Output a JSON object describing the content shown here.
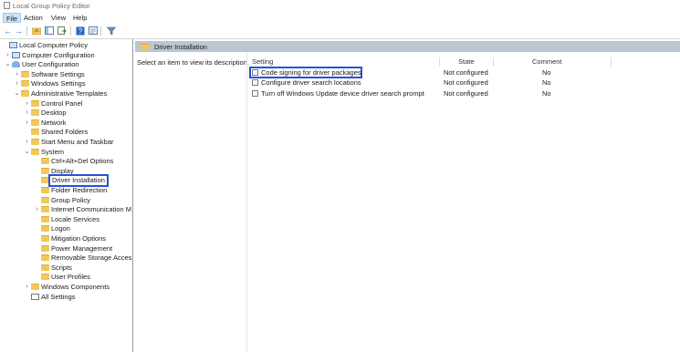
{
  "window": {
    "title": "Local Group Policy Editor"
  },
  "menu": [
    "File",
    "Action",
    "View",
    "Help"
  ],
  "toolbar": {
    "buttons": [
      "back-icon",
      "forward-icon",
      "up-folder-icon",
      "show-hide-tree-icon",
      "export-list-icon",
      "help-icon",
      "properties-view-icon",
      "filter-icon"
    ]
  },
  "tree": {
    "items": [
      {
        "label": "Local Computer Policy",
        "icon": "computer-icon",
        "expander": ""
      },
      {
        "label": "Computer Configuration",
        "icon": "computer-icon",
        "expander": ">"
      },
      {
        "label": "User Configuration",
        "icon": "person-icon",
        "expander": "v"
      },
      {
        "label": "Software Settings",
        "icon": "folder-icon",
        "expander": ">"
      },
      {
        "label": "Windows Settings",
        "icon": "folder-icon",
        "expander": ">"
      },
      {
        "label": "Administrative Templates",
        "icon": "folder-icon",
        "expander": "v"
      },
      {
        "label": "Control Panel",
        "icon": "folder-icon",
        "expander": ">"
      },
      {
        "label": "Desktop",
        "icon": "folder-icon",
        "expander": ">"
      },
      {
        "label": "Network",
        "icon": "folder-icon",
        "expander": ">"
      },
      {
        "label": "Shared Folders",
        "icon": "folder-icon",
        "expander": ""
      },
      {
        "label": "Start Menu and Taskbar",
        "icon": "folder-icon",
        "expander": ">"
      },
      {
        "label": "System",
        "icon": "folder-icon",
        "expander": "v"
      },
      {
        "label": "Ctrl+Alt+Del Options",
        "icon": "folder-icon",
        "expander": ""
      },
      {
        "label": "Display",
        "icon": "folder-icon",
        "expander": ""
      },
      {
        "label": "Driver Installation",
        "icon": "folder-icon",
        "expander": "",
        "selected": true
      },
      {
        "label": "Folder Redirection",
        "icon": "folder-icon",
        "expander": ""
      },
      {
        "label": "Group Policy",
        "icon": "folder-icon",
        "expander": ""
      },
      {
        "label": "Internet Communication M",
        "icon": "folder-icon",
        "expander": ">"
      },
      {
        "label": "Locale Services",
        "icon": "folder-icon",
        "expander": ""
      },
      {
        "label": "Logon",
        "icon": "folder-icon",
        "expander": ""
      },
      {
        "label": "Mitigation Options",
        "icon": "folder-icon",
        "expander": ""
      },
      {
        "label": "Power Management",
        "icon": "folder-icon",
        "expander": ""
      },
      {
        "label": "Removable Storage Acces",
        "icon": "folder-icon",
        "expander": ""
      },
      {
        "label": "Scripts",
        "icon": "folder-icon",
        "expander": ""
      },
      {
        "label": "User Profiles",
        "icon": "folder-icon",
        "expander": ""
      },
      {
        "label": "Windows Components",
        "icon": "folder-icon",
        "expander": ">"
      },
      {
        "label": "All Settings",
        "icon": "all-settings-icon",
        "expander": ""
      }
    ]
  },
  "details": {
    "header_title": "Driver Installation",
    "description": "Select an item to view its description.",
    "columns": {
      "setting": "Setting",
      "state": "State",
      "comment": "Comment"
    },
    "rows": [
      {
        "name": "Code signing for driver packages",
        "state": "Not configured",
        "comment": "No",
        "highlighted": true
      },
      {
        "name": "Configure driver search locations",
        "state": "Not configured",
        "comment": "No"
      },
      {
        "name": "Turn off Windows Update device driver search prompt",
        "state": "Not configured",
        "comment": "No"
      }
    ]
  },
  "colors": {
    "highlight_outline": "#2b4fd9",
    "header_bar": "#bcc5d2",
    "folder": "#f2c85a"
  }
}
